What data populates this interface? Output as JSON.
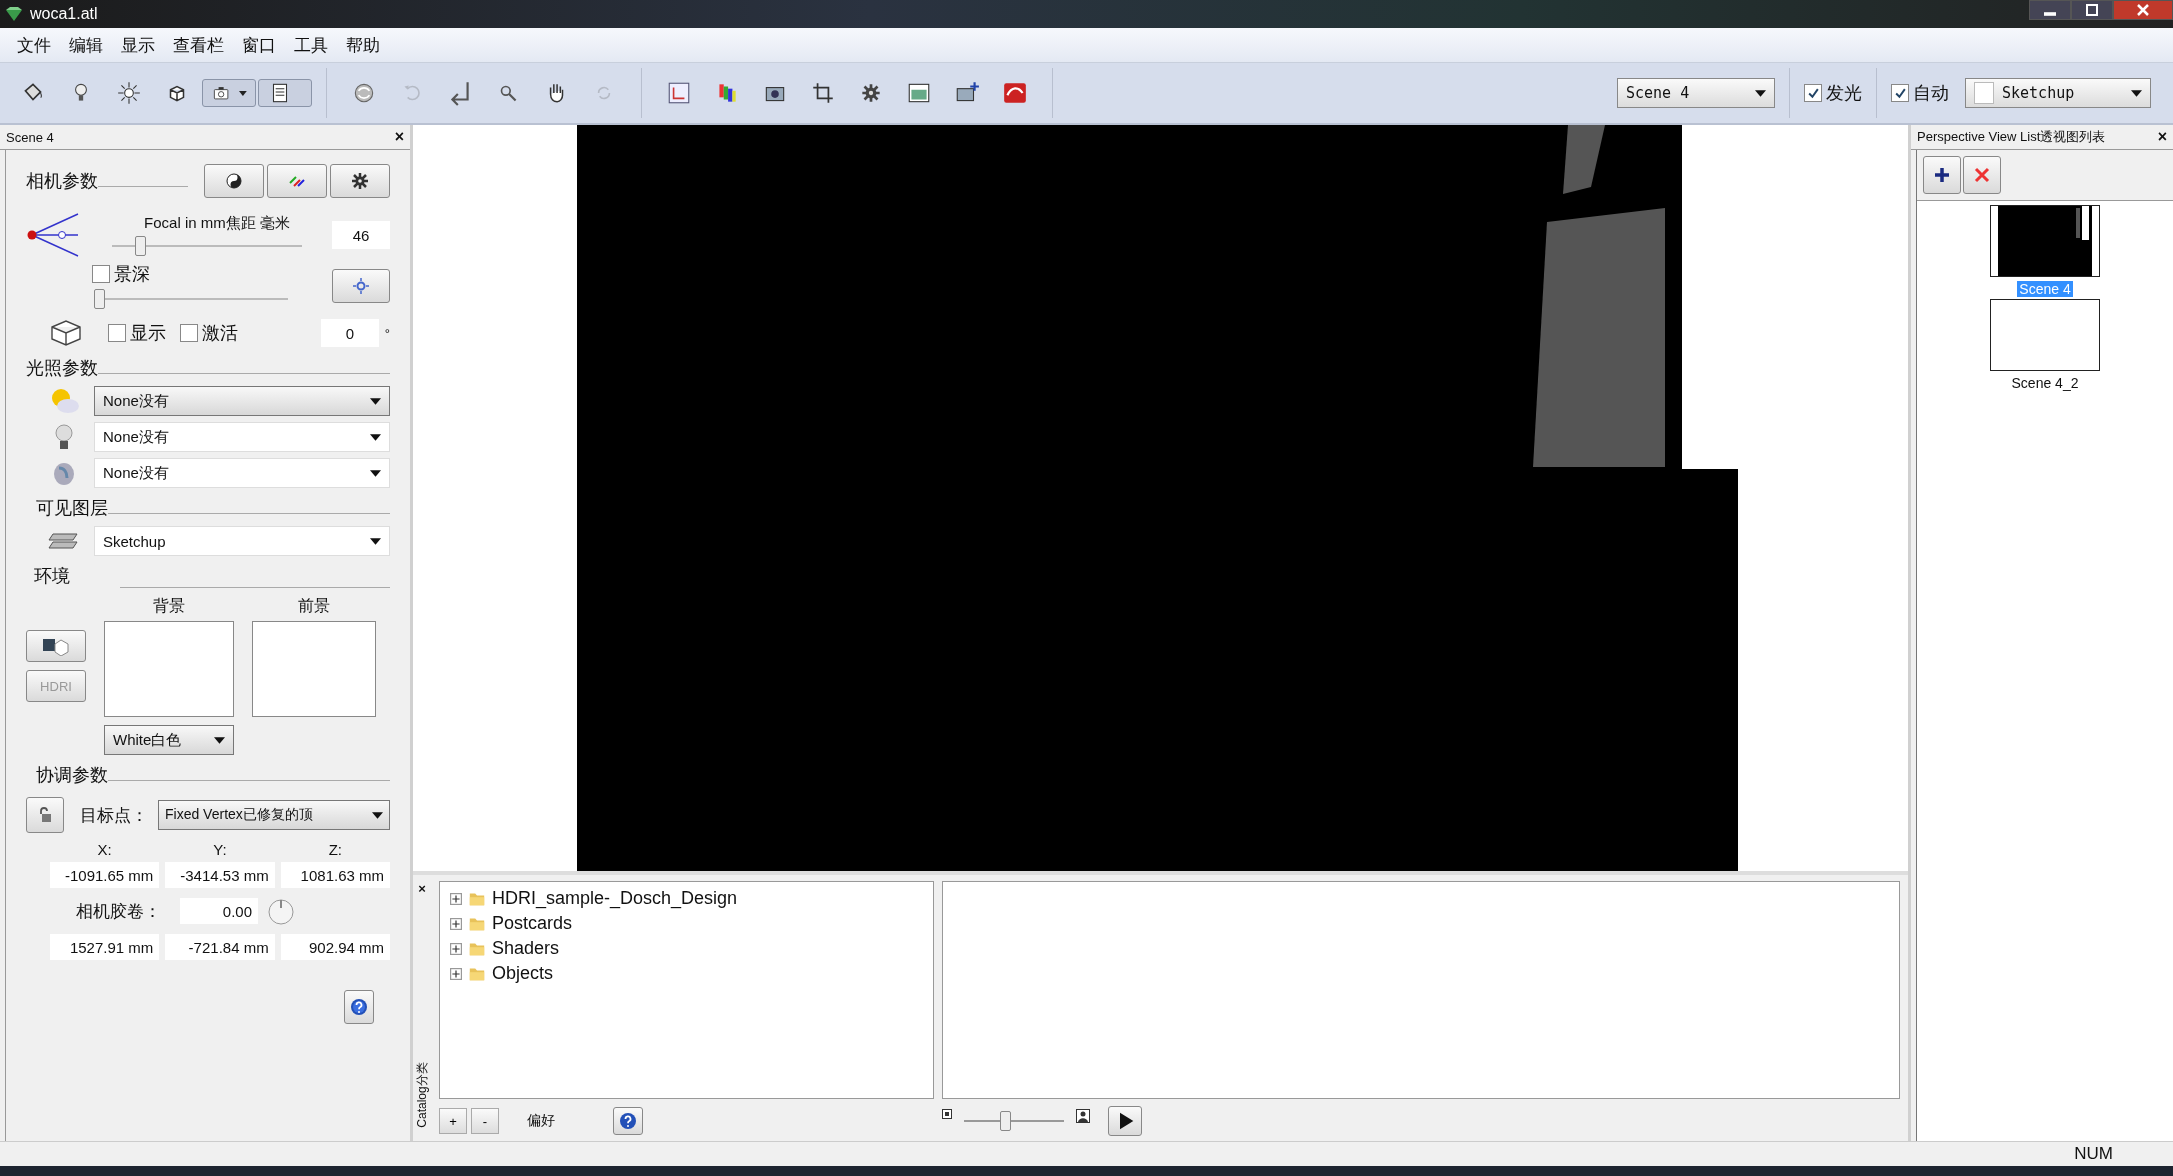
{
  "window": {
    "title": "woca1.atl"
  },
  "menu": [
    "文件",
    "编辑",
    "显示",
    "查看栏",
    "窗口",
    "工具",
    "帮助"
  ],
  "toolbar": [
    [
      {
        "kind": "bucket",
        "selected": false,
        "disabled": false
      },
      {
        "kind": "bulb",
        "selected": false,
        "disabled": false
      },
      {
        "kind": "sun",
        "selected": false,
        "disabled": false
      },
      {
        "kind": "cube",
        "selected": false,
        "disabled": false
      },
      {
        "kind": "camera",
        "selected": true,
        "disabled": false
      },
      {
        "kind": "sheet",
        "selected": true,
        "disabled": false
      }
    ],
    [
      {
        "kind": "orbit",
        "selected": false,
        "disabled": false
      },
      {
        "kind": "undo",
        "selected": false,
        "disabled": true
      },
      {
        "kind": "enter",
        "selected": false,
        "disabled": false
      },
      {
        "kind": "zoom",
        "selected": false,
        "disabled": false
      },
      {
        "kind": "hand",
        "selected": false,
        "disabled": false
      },
      {
        "kind": "refresh",
        "selected": false,
        "disabled": true
      }
    ],
    [
      {
        "kind": "axes",
        "selected": false,
        "disabled": false
      },
      {
        "kind": "palette",
        "selected": false,
        "disabled": false
      },
      {
        "kind": "photo",
        "selected": false,
        "disabled": false
      },
      {
        "kind": "crop",
        "selected": false,
        "disabled": false
      },
      {
        "kind": "gear",
        "selected": false,
        "disabled": false
      },
      {
        "kind": "picture",
        "selected": false,
        "disabled": false
      },
      {
        "kind": "addpicture",
        "selected": false,
        "disabled": false
      },
      {
        "kind": "render",
        "selected": false,
        "disabled": false
      }
    ]
  ],
  "scene_select": {
    "value": "Scene 4"
  },
  "glow": {
    "label": "发光",
    "checked": true
  },
  "auto": {
    "label": "自动",
    "checked": true
  },
  "layer_select": {
    "value": "Sketchup"
  },
  "left_panel": {
    "title": "Scene 4",
    "close": "×",
    "camera": {
      "heading": "相机参数",
      "focal_label": "Focal in mm焦距 毫米",
      "focal_slider": {
        "level": 0.14
      },
      "focal_value": "46",
      "dof": {
        "label": "景深",
        "checked": false
      },
      "dof_slider": {
        "level": 0
      },
      "show": {
        "label": "显示",
        "checked": false
      },
      "activate": {
        "label": "激活",
        "checked": false
      },
      "angle_value": "0",
      "angle_unit": "°"
    },
    "lighting": {
      "heading": "光照参数",
      "selects": [
        {
          "kind": "sun",
          "value": "None没有",
          "selected": true
        },
        {
          "kind": "bulb",
          "value": "None没有",
          "selected": false
        },
        {
          "kind": "cloud",
          "value": "None没有",
          "selected": false
        }
      ]
    },
    "layers": {
      "heading": "可见图层",
      "value": "Sketchup"
    },
    "environment": {
      "heading": "环境",
      "background_label": "背景",
      "foreground_label": "前景",
      "hdri_button": "HDRI",
      "background_select": "White白色"
    },
    "adjust": {
      "heading": "协调参数",
      "target_label": "目标点：",
      "target_value": "Fixed Vertex已修复的顶",
      "axes": [
        "X:",
        "Y:",
        "Z:"
      ],
      "target_coords": [
        "-1091.65 mm",
        "-3414.53 mm",
        "1081.63 mm"
      ],
      "roll_label": "相机胶卷：",
      "roll_value": "0.00",
      "camera_coords": [
        "1527.91 mm",
        "-721.84 mm",
        "902.94 mm"
      ]
    }
  },
  "catalog": {
    "close": "×",
    "side_label": "Catalog分类",
    "folders": [
      "HDRI_sample-_Dosch_Design",
      "Postcards",
      "Shaders",
      "Objects"
    ],
    "add": "+",
    "remove": "-",
    "favorites_label": "偏好",
    "thumb_size_slider": {
      "level": 0.4
    }
  },
  "perspective_list": {
    "title": "Perspective View List透视图列表",
    "close": "×",
    "views": [
      {
        "name": "Scene 4",
        "selected": true,
        "kind": "render"
      },
      {
        "name": "Scene 4_2",
        "selected": false,
        "kind": "blank"
      }
    ]
  },
  "status_bar": {
    "indicator": "NUM"
  }
}
